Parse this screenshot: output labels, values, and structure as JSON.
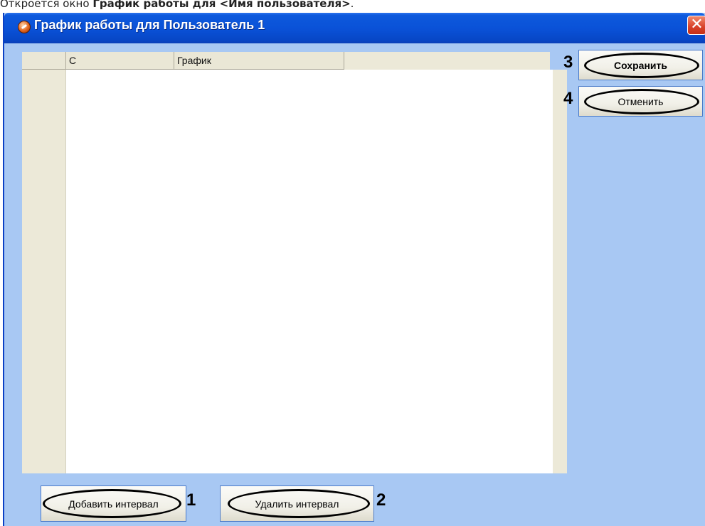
{
  "doc": {
    "prefix": "Откроется окно ",
    "bold": "График работы для <Имя пользователя>",
    "suffix": "."
  },
  "window": {
    "title": "График работы для Пользователь 1",
    "close_glyph": "✕"
  },
  "grid": {
    "columns": [
      "",
      "С",
      "График"
    ]
  },
  "buttons": {
    "save": "Сохранить",
    "cancel": "Отменить",
    "add_interval": "Добавить интервал",
    "delete_interval": "Удалить интервал"
  },
  "markers": {
    "add": "1",
    "delete": "2",
    "save": "3",
    "cancel": "4"
  },
  "colors": {
    "window_bg": "#a8c8f3",
    "titlebar": "#0a52d8",
    "close": "#d8412a"
  }
}
